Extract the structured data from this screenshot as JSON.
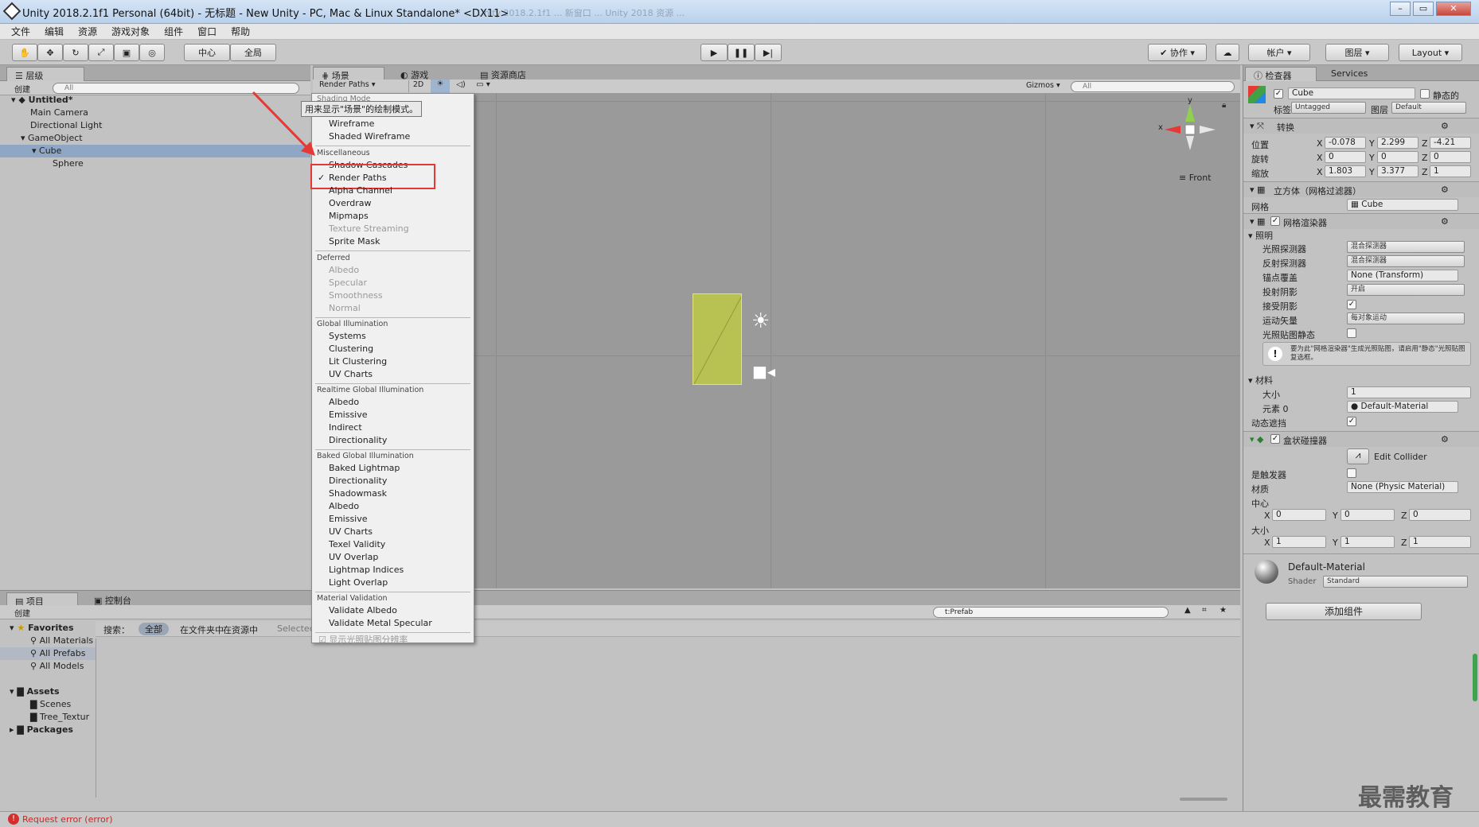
{
  "window": {
    "title": "Unity 2018.2.1f1 Personal (64bit) - 无标题 - New Unity - PC, Mac & Linux Standalone* <DX11>",
    "background_tabs": "Unity 2018.2.1f1 ...    新窗口 ...    Unity 2018 资源 ..."
  },
  "menubar": [
    "文件",
    "编辑",
    "资源",
    "游戏对象",
    "组件",
    "窗口",
    "帮助"
  ],
  "toolbar": {
    "pivot": "中心",
    "global": "全局",
    "collab": "协作",
    "account": "帐户",
    "layers": "图层",
    "layout": "Layout"
  },
  "hierarchy": {
    "tab": "层级",
    "create": "创建",
    "search_placeholder": "All",
    "scene": "Untitled*",
    "items": [
      "Main Camera",
      "Directional Light",
      "GameObject",
      "Cube",
      "Sphere"
    ]
  },
  "scene_view": {
    "tabs": [
      "场景",
      "游戏",
      "资源商店"
    ],
    "shading_dropdown": "Render Paths",
    "toggle_2d": "2D",
    "gizmos": "Gizmos",
    "search_placeholder": "All",
    "shading_mode_header": "Shading Mode",
    "tooltip": "用来显示\"场景\"的绘制模式。",
    "gizmo_front": "Front",
    "axis_y": "y",
    "axis_x": "x"
  },
  "shading_menu": {
    "top_items": [
      "Wireframe",
      "Shaded Wireframe"
    ],
    "misc_header": "Miscellaneous",
    "misc_items": [
      {
        "label": "Shadow Cascades",
        "disabled": false
      },
      {
        "label": "Render Paths",
        "checked": true
      },
      {
        "label": "Alpha Channel"
      },
      {
        "label": "Overdraw"
      },
      {
        "label": "Mipmaps"
      },
      {
        "label": "Texture Streaming",
        "disabled": true
      },
      {
        "label": "Sprite Mask"
      }
    ],
    "deferred_header": "Deferred",
    "deferred_items": [
      "Albedo",
      "Specular",
      "Smoothness",
      "Normal"
    ],
    "gi_header": "Global Illumination",
    "gi_items": [
      "Systems",
      "Clustering",
      "Lit Clustering",
      "UV Charts"
    ],
    "rgi_header": "Realtime Global Illumination",
    "rgi_items": [
      "Albedo",
      "Emissive",
      "Indirect",
      "Directionality"
    ],
    "bgi_header": "Baked Global Illumination",
    "bgi_items": [
      "Baked Lightmap",
      "Directionality",
      "Shadowmask",
      "Albedo",
      "Emissive",
      "UV Charts",
      "Texel Validity",
      "UV Overlap",
      "Lightmap Indices",
      "Light Overlap"
    ],
    "mv_header": "Material Validation",
    "mv_items": [
      "Validate Albedo",
      "Validate Metal Specular"
    ],
    "footer": "显示光照贴图分辨率"
  },
  "inspector": {
    "tabs": [
      "检查器",
      "Services"
    ],
    "object_name": "Cube",
    "static_label": "静态的",
    "tag_label": "标签",
    "tag_value": "Untagged",
    "layer_label": "图层",
    "layer_value": "Default",
    "transform": {
      "title": "转换",
      "position_label": "位置",
      "rotation_label": "旋转",
      "scale_label": "缩放",
      "position": [
        "-0.078",
        "2.299",
        "-4.21"
      ],
      "rotation": [
        "0",
        "0",
        "0"
      ],
      "scale": [
        "1.803",
        "3.377",
        "1"
      ]
    },
    "mesh_filter": {
      "title": "立方体（网格过滤器）",
      "mesh_label": "网格",
      "mesh_value": "Cube"
    },
    "mesh_renderer": {
      "title": "网格渲染器",
      "lighting_label": "照明",
      "rows": [
        {
          "label": "光照探测器",
          "value": "混合探测器"
        },
        {
          "label": "反射探测器",
          "value": "混合探测器"
        },
        {
          "label": "锚点覆盖",
          "value": "None (Transform)"
        },
        {
          "label": "投射阴影",
          "value": "开启"
        },
        {
          "label": "接受阴影",
          "value": ""
        },
        {
          "label": "运动矢量",
          "value": "每对象运动"
        },
        {
          "label": "光照贴图静态",
          "value": ""
        }
      ],
      "info": "要为此\"网格渲染器\"生成光照贴图，请启用\"静态\"光照贴图复选框。",
      "materials_label": "材料",
      "size_label": "大小",
      "size_value": "1",
      "element0_label": "元素 0",
      "element0_value": "Default-Material",
      "dynamic_occluded_label": "动态遮挡"
    },
    "box_collider": {
      "title": "盒状碰撞器",
      "edit_collider": "Edit Collider",
      "trigger_label": "是触发器",
      "material_label": "材质",
      "material_value": "None (Physic Material)",
      "center_label": "中心",
      "center": [
        "0",
        "0",
        "0"
      ],
      "size_label": "大小",
      "size": [
        "1",
        "1",
        "1"
      ]
    },
    "material": {
      "name": "Default-Material",
      "shader_label": "Shader",
      "shader_value": "Standard"
    },
    "add_component": "添加组件"
  },
  "project": {
    "tabs": [
      "项目",
      "控制台"
    ],
    "create": "创建",
    "search_label": "搜索：",
    "filter_all": "全部",
    "filter_in_folder": "在文件夹中",
    "filter_in_store": "在资源中",
    "filter_selected": "Selected",
    "search_value": "t:Prefab",
    "favorites_label": "Favorites",
    "favorites": [
      "All Materials",
      "All Prefabs",
      "All Models"
    ],
    "assets_label": "Assets",
    "assets": [
      "Scenes",
      "Tree_Textur"
    ],
    "packages_label": "Packages"
  },
  "status": {
    "error": "Request error (error)"
  },
  "watermark": "最需教育"
}
